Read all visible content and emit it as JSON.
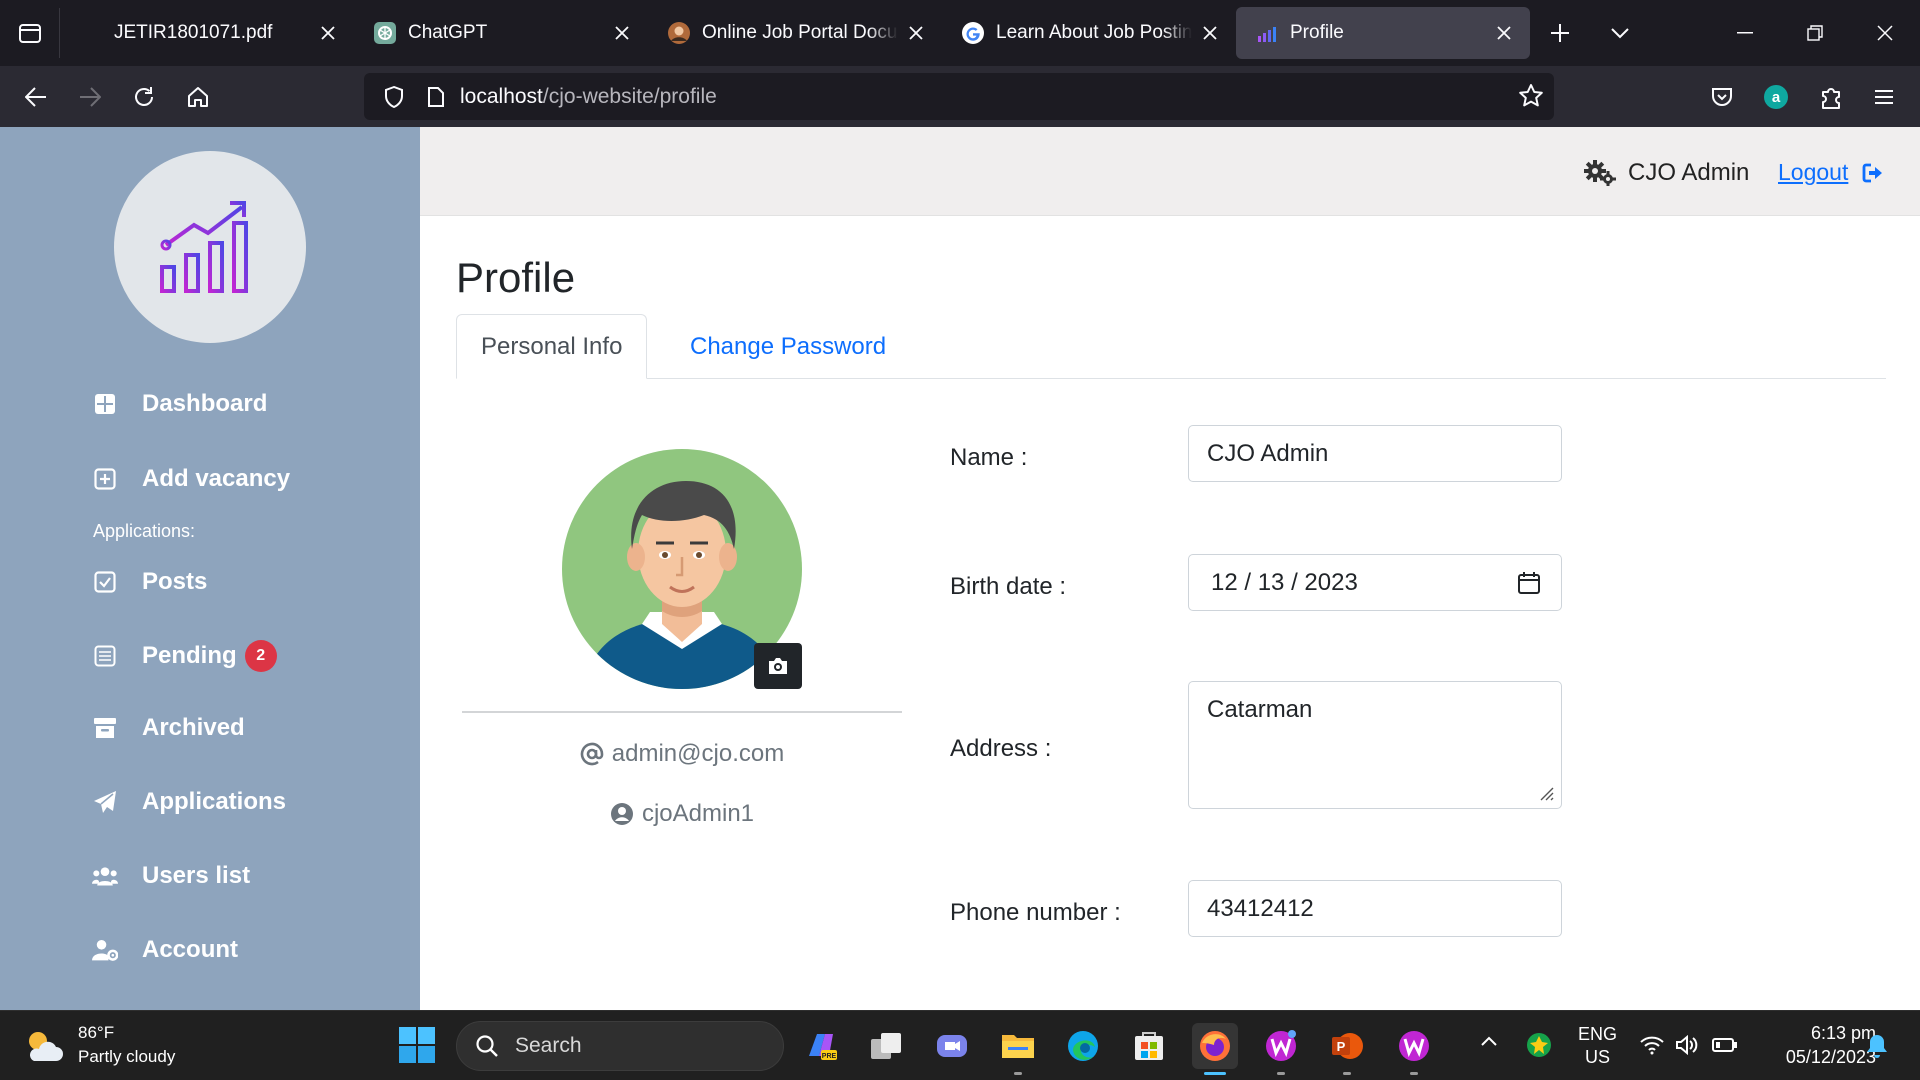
{
  "browser": {
    "tabs": [
      {
        "title": "JETIR1801071.pdf",
        "icon": "pdf-icon"
      },
      {
        "title": "ChatGPT",
        "icon": "chatgpt-icon"
      },
      {
        "title": "Online Job Portal Documentation",
        "icon": "document-avatar-icon"
      },
      {
        "title": "Learn About Job Posting Sites",
        "icon": "google-icon"
      },
      {
        "title": "Profile",
        "icon": "chart-favicon"
      }
    ],
    "url_host": "localhost",
    "url_path": "/cjo-website/profile"
  },
  "sidebar": {
    "items": [
      {
        "label": "Dashboard",
        "icon": "grid-icon"
      },
      {
        "label": "Add vacancy",
        "icon": "plus-square-icon"
      },
      {
        "label": "Posts",
        "icon": "check-square-icon"
      },
      {
        "label": "Pending",
        "icon": "list-icon",
        "badge": "2"
      },
      {
        "label": "Archived",
        "icon": "archive-icon"
      },
      {
        "label": "Applications",
        "icon": "paper-plane-icon"
      },
      {
        "label": "Users list",
        "icon": "users-icon"
      },
      {
        "label": "Account",
        "icon": "user-gear-icon"
      }
    ],
    "section_label": "Applications:"
  },
  "header": {
    "admin_name": "CJO Admin",
    "logout_label": "Logout"
  },
  "main": {
    "title": "Profile",
    "tabs": [
      {
        "label": "Personal Info",
        "active": true
      },
      {
        "label": "Change Password",
        "active": false
      }
    ],
    "profile": {
      "email": "admin@cjo.com",
      "username": "cjoAdmin1"
    },
    "form": {
      "name_label": "Name :",
      "name_value": "CJO Admin",
      "birth_label": "Birth date :",
      "birth_value": "12 / 13 / 2023",
      "address_label": "Address :",
      "address_value": "Catarman",
      "phone_label": "Phone number :",
      "phone_value": "43412412"
    }
  },
  "taskbar": {
    "weather_temp": "86°F",
    "weather_desc": "Partly cloudy",
    "search_placeholder": "Search",
    "lang_line1": "ENG",
    "lang_line2": "US",
    "time": "6:13 pm",
    "date": "05/12/2023"
  },
  "colors": {
    "sidebar": "#8ea4bd",
    "link": "#0d6efd",
    "badge": "#dc3545",
    "avatar_bg": "#90c67f"
  }
}
